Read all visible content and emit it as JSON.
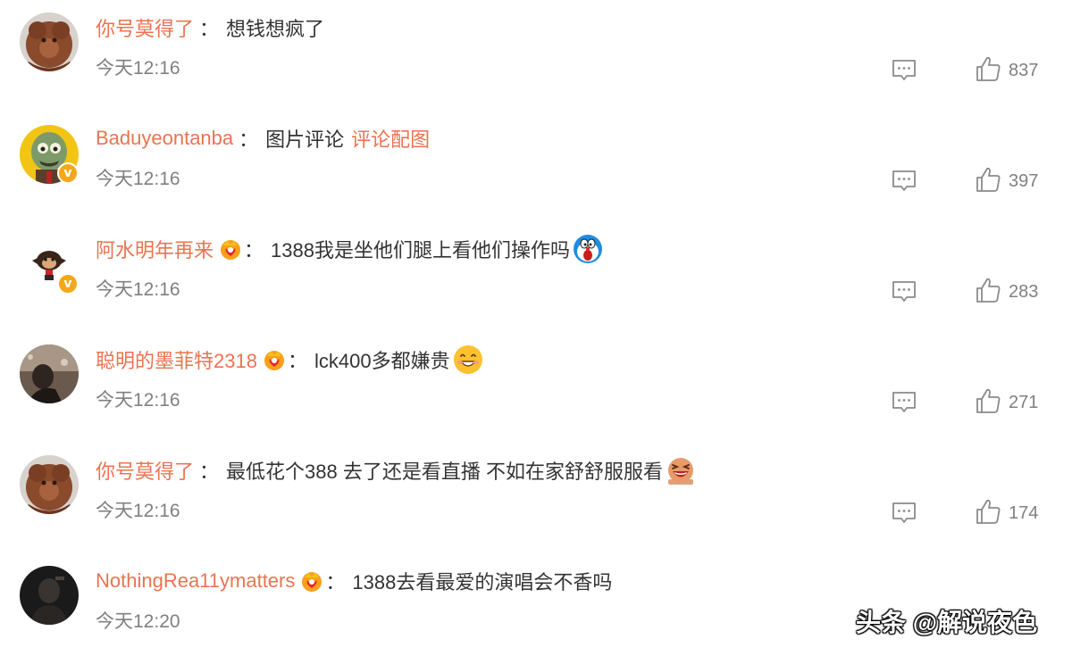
{
  "comments": [
    {
      "username": "你号莫得了",
      "separator": "：",
      "text": "想钱想疯了",
      "link_text": "",
      "time": "今天12:16",
      "likes": "837",
      "verified": false,
      "crown_badge": false,
      "emoji": "",
      "avatar_icon": "teddy-bear-avatar"
    },
    {
      "username": "Baduyeontanba",
      "separator": "：",
      "text": "图片评论",
      "link_text": "评论配图",
      "time": "今天12:16",
      "likes": "397",
      "verified": true,
      "crown_badge": false,
      "emoji": "",
      "avatar_icon": "zombie-avatar"
    },
    {
      "username": "阿水明年再来",
      "separator": "：",
      "text": "1388我是坐他们腿上看他们操作吗",
      "link_text": "",
      "time": "今天12:16",
      "likes": "283",
      "verified": true,
      "crown_badge": true,
      "emoji": "doraemon-shocked",
      "avatar_icon": "monkey-avatar"
    },
    {
      "username": "聪明的墨菲特2318",
      "separator": "：",
      "text": "lck400多都嫌贵",
      "link_text": "",
      "time": "今天12:16",
      "likes": "271",
      "verified": false,
      "crown_badge": true,
      "emoji": "grinning-face",
      "avatar_icon": "dark-photo-avatar"
    },
    {
      "username": "你号莫得了",
      "separator": "：",
      "text": "最低花个388 去了还是看直播 不如在家舒舒服服看",
      "link_text": "",
      "time": "今天12:16",
      "likes": "174",
      "verified": false,
      "crown_badge": false,
      "emoji": "laughing-face",
      "avatar_icon": "teddy-bear-avatar"
    },
    {
      "username": "NothingRea11ymatters",
      "separator": "：",
      "text": "1388去看最爱的演唱会不香吗",
      "link_text": "",
      "time": "今天12:20",
      "likes": "",
      "verified": false,
      "crown_badge": true,
      "emoji": "",
      "avatar_icon": "portrait-avatar"
    }
  ],
  "watermark": "头条 @解说夜色",
  "icons": {
    "reply": "comment-icon",
    "like": "thumbs-up-icon",
    "crown": "crown-badge-icon",
    "verified": "verified-v-icon"
  },
  "colors": {
    "username": "#eb7350",
    "text": "#333333",
    "meta": "#808080",
    "verified": "#f3a81b"
  }
}
